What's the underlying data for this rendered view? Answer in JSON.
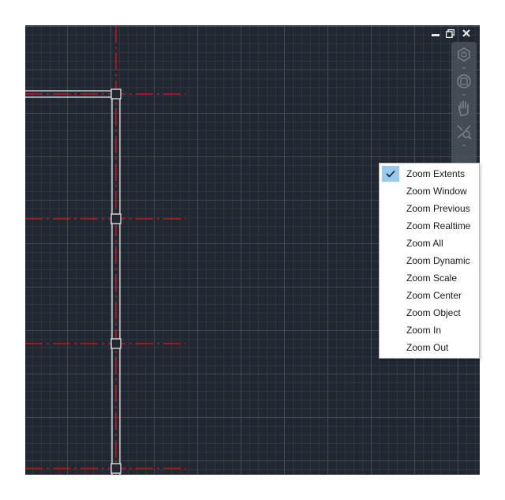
{
  "viewport": {
    "window_controls": {
      "minimize_icon": "minimize-icon",
      "restore_icon": "restore-icon",
      "close_icon": "close-icon"
    },
    "navigation_bar": {
      "tools": [
        "steering-wheel-icon",
        "view-cube-icon",
        "pan-hand-icon",
        "zoom-extents-icon"
      ]
    },
    "colors": {
      "background": "#212832",
      "grid_major": "#4e5c6c",
      "centerline": "#c8161d",
      "geometry": "#e6e6e6"
    }
  },
  "zoom_menu": {
    "items": [
      {
        "label": "Zoom Extents",
        "checked": true
      },
      {
        "label": "Zoom Window",
        "checked": false
      },
      {
        "label": "Zoom Previous",
        "checked": false
      },
      {
        "label": "Zoom Realtime",
        "checked": false
      },
      {
        "label": "Zoom All",
        "checked": false
      },
      {
        "label": "Zoom Dynamic",
        "checked": false
      },
      {
        "label": "Zoom Scale",
        "checked": false
      },
      {
        "label": "Zoom Center",
        "checked": false
      },
      {
        "label": "Zoom Object",
        "checked": false
      },
      {
        "label": "Zoom In",
        "checked": false
      },
      {
        "label": "Zoom Out",
        "checked": false
      }
    ],
    "highlight_color": "#99c9ef"
  }
}
